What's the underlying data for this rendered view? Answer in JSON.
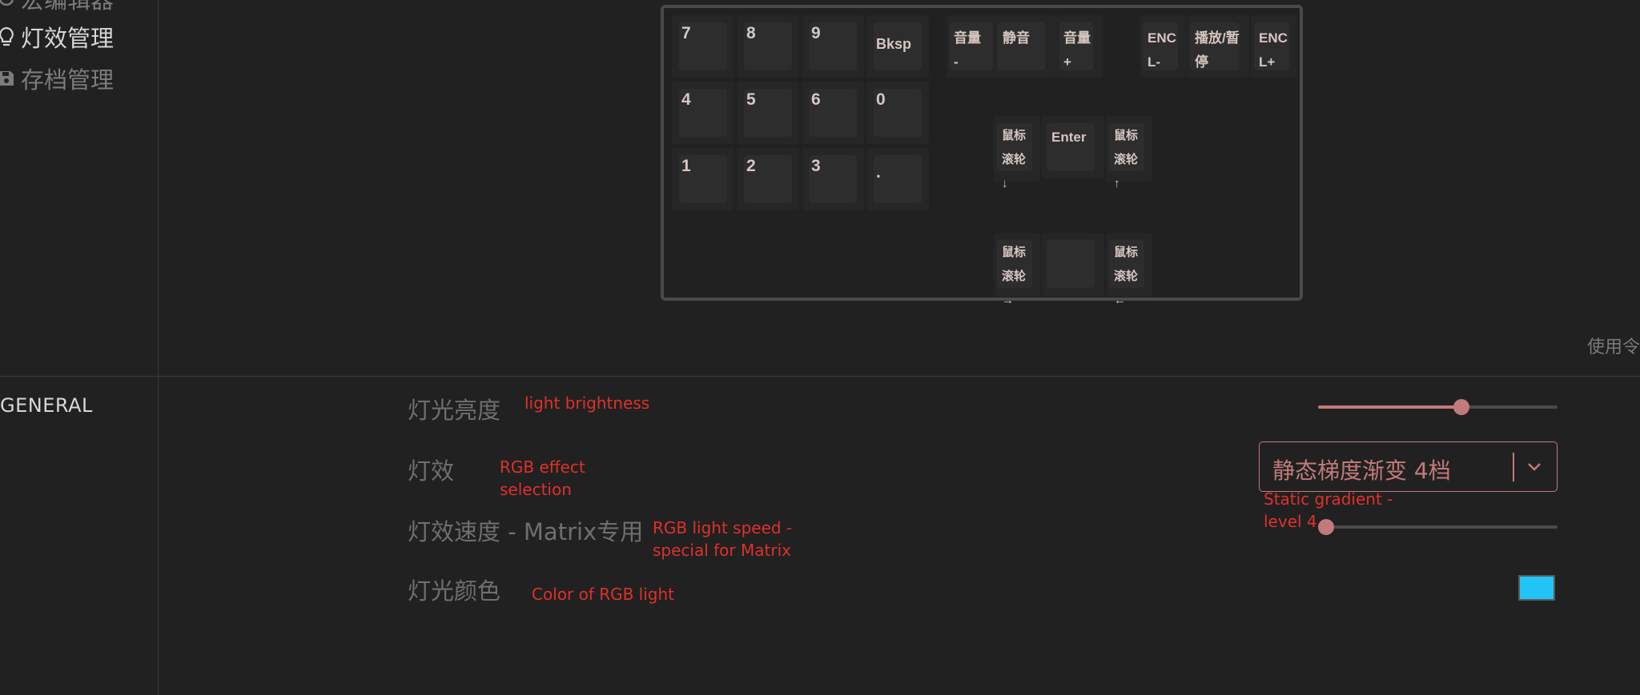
{
  "sidebar": {
    "items": [
      {
        "label": "宏编辑器",
        "icon": "circle-icon"
      },
      {
        "label": "灯效管理",
        "icon": "lightbulb-icon",
        "active": true
      },
      {
        "label": "存档管理",
        "icon": "save-icon"
      }
    ]
  },
  "keyboard": {
    "keys": [
      {
        "label": "7"
      },
      {
        "label": "8"
      },
      {
        "label": "9"
      },
      {
        "label": "Bksp"
      },
      {
        "label": "4"
      },
      {
        "label": "5"
      },
      {
        "label": "6"
      },
      {
        "label": "0"
      },
      {
        "label": "1"
      },
      {
        "label": "2"
      },
      {
        "label": "3"
      },
      {
        "label": "."
      },
      {
        "label": "音量\n-"
      },
      {
        "label": "静音"
      },
      {
        "label": "音量\n+"
      },
      {
        "label": "ENC\nL-"
      },
      {
        "label": "播放/暂\n停"
      },
      {
        "label": "ENC\nL+"
      },
      {
        "label": "鼠标\n滚轮\n↓"
      },
      {
        "label": "Enter"
      },
      {
        "label": "鼠标\n滚轮\n↑"
      },
      {
        "label": "鼠标\n滚轮\n→"
      },
      {
        "label": ""
      },
      {
        "label": "鼠标\n滚轮\n←"
      }
    ]
  },
  "hint": "使用令",
  "general": {
    "title": "GENERAL",
    "brightness": {
      "label": "灯光亮度",
      "annotation": "light brightness",
      "value_pct": 60
    },
    "effect": {
      "label": "灯效",
      "annotation": "RGB effect\nselection",
      "selected": "静态梯度渐变 4档",
      "selected_annotation": "Static gradient -\nlevel 4"
    },
    "speed": {
      "label": "灯效速度 - Matrix专用",
      "annotation": "RGB light speed -\nspecial for Matrix",
      "value_pct": 0
    },
    "color": {
      "label": "灯光颜色",
      "annotation": "Color of RGB light",
      "value": "#22c4f8"
    }
  },
  "colors": {
    "accent": "#c27a7a",
    "annotation": "#e0302a"
  }
}
